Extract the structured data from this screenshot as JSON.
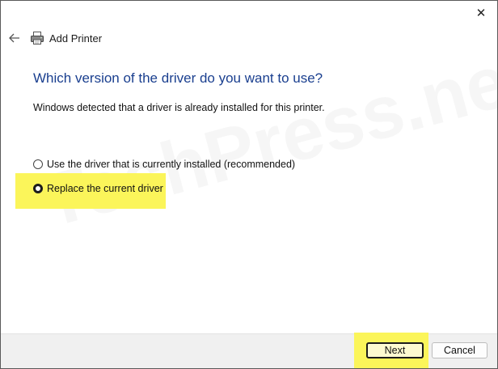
{
  "window": {
    "close_glyph": "✕",
    "back_icon": "back-arrow-icon",
    "title_icon": "printer-icon",
    "title": "Add Printer"
  },
  "content": {
    "question": "Which version of the driver do you want to use?",
    "description": "Windows detected that a driver is already installed for this printer.",
    "watermark": "TechPress.net",
    "options": [
      {
        "label": "Use the driver that is currently installed (recommended)",
        "selected": false
      },
      {
        "label": "Replace the current driver",
        "selected": true
      }
    ]
  },
  "footer": {
    "next_label": "Next",
    "cancel_label": "Cancel"
  },
  "colors": {
    "heading": "#1a3f8f",
    "highlight": "#fbf55a",
    "footer_bg": "#f0f0f0"
  }
}
